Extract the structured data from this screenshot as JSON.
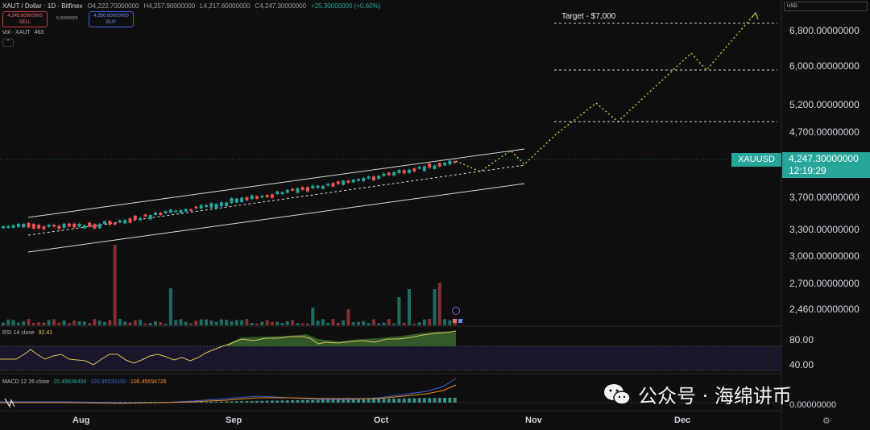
{
  "header": {
    "symbol": "XAUT / Dollar · 1D · Bitfinex",
    "open": "O4,222.70000000",
    "high": "H4,257.90000000",
    "low": "L4,217.60000000",
    "close": "C4,247.30000000",
    "change": "+25.30000000 (+0.60%)"
  },
  "trade": {
    "sell_price": "4,245.60000000",
    "sell_label": "SELL",
    "spread": "5.00000000",
    "buy_price": "4,350.60000000",
    "buy_label": "BUY"
  },
  "volume_legend": {
    "label": "Vol · XAUT",
    "value": "463"
  },
  "collapse_icon": "chevron-up-icon",
  "currency": "USD",
  "target_label": "Target - $7,000",
  "price_axis": {
    "labels": [
      "6,800.00000000",
      "6,000.00000000",
      "5,200.00000000",
      "4,700.00000000",
      "3,700.00000000",
      "3,300.00000000",
      "3,000.00000000",
      "2,700.00000000",
      "2,460.00000000"
    ],
    "current_symbol": "XAUUSD",
    "current_price": "4,247.30000000",
    "countdown": "12:19:29"
  },
  "rsi": {
    "label": "RSI 14 close",
    "value": "92.41",
    "levels": [
      "80.00",
      "40.00"
    ]
  },
  "macd": {
    "label": "MACD 12 26 close",
    "v1": "20.49838404",
    "v2": "126.95533150",
    "v3": "106.45694726",
    "zero": "0.00000000"
  },
  "time_axis": {
    "months": [
      "Aug",
      "Sep",
      "Oct",
      "Nov",
      "Dec"
    ]
  },
  "watermark": {
    "text": "公众号 · 海绵讲币"
  },
  "colors": {
    "up": "#26a69a",
    "down": "#ef5350",
    "accent": "#26a69a",
    "projection": "#9ad94a"
  }
}
